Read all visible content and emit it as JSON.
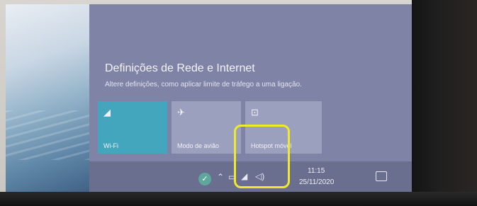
{
  "panel": {
    "title": "Definições de Rede e Internet",
    "subtitle": "Altere definições, como aplicar limite de tráfego a uma ligação."
  },
  "tiles": [
    {
      "label": "Wi-Fi",
      "icon": "wifi-icon",
      "active": true
    },
    {
      "label": "Modo de avião",
      "icon": "airplane-icon",
      "active": false
    },
    {
      "label": "Hotspot móvel",
      "icon": "hotspot-icon",
      "active": false
    }
  ],
  "taskbar": {
    "time": "11:15",
    "date": "25/11/2020"
  },
  "colors": {
    "active_tile": "#43a6bd",
    "inactive_tile": "#9aa0be",
    "panel_bg": "#7f84a6",
    "highlight": "#f0e92a"
  }
}
